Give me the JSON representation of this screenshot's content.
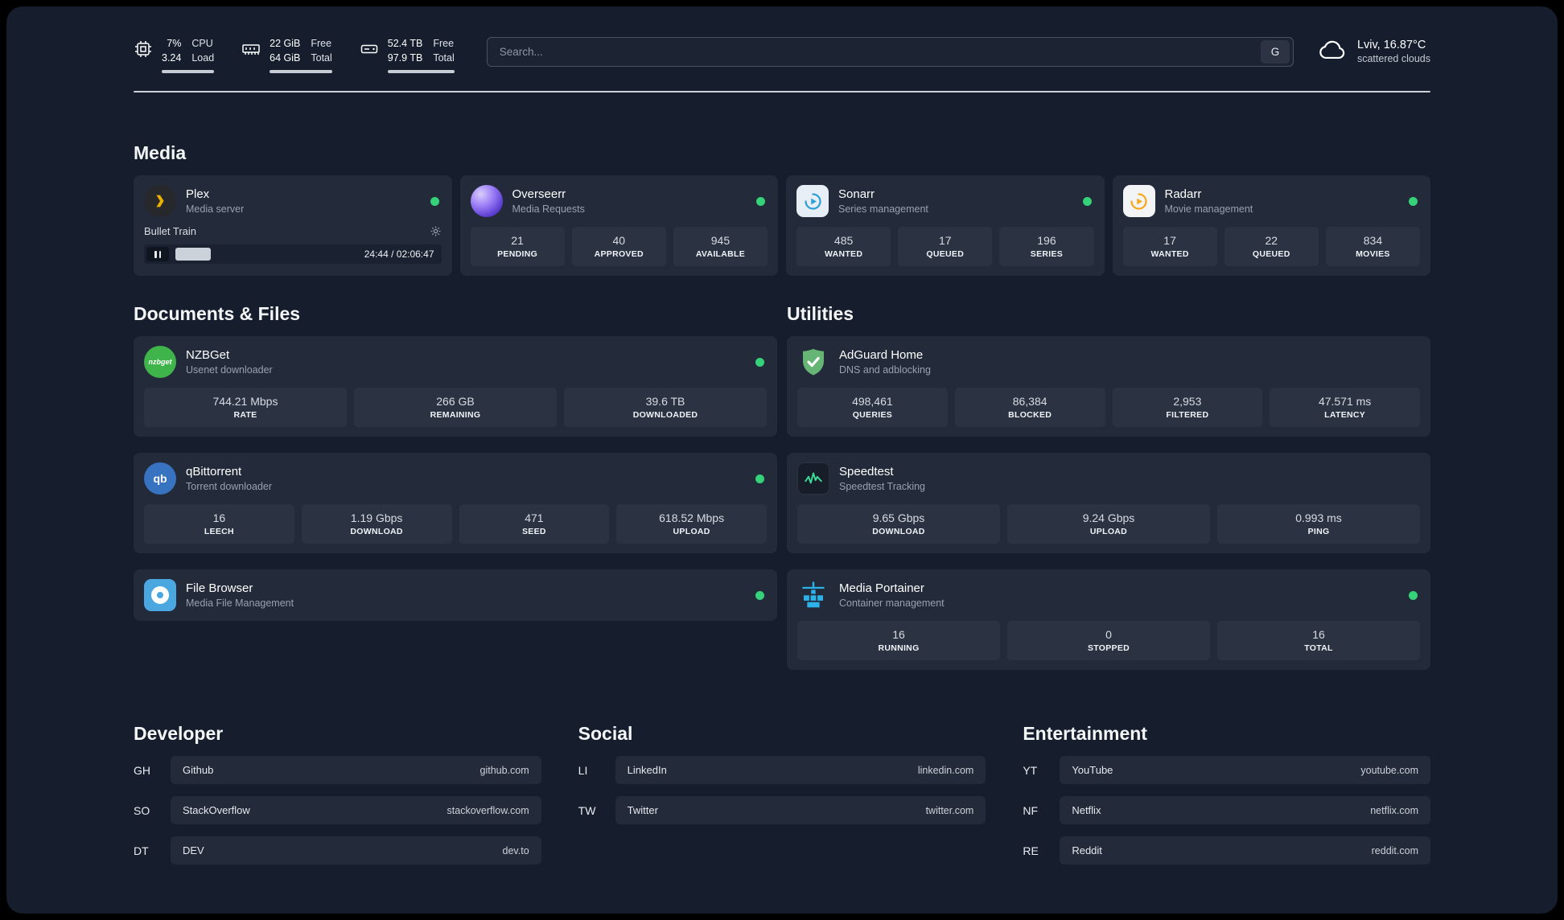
{
  "topbar": {
    "cpu": {
      "value_top": "7%",
      "value_bottom": "3.24",
      "label_top": "CPU",
      "label_bottom": "Load"
    },
    "ram": {
      "value_top": "22 GiB",
      "value_bottom": "64 GiB",
      "label_top": "Free",
      "label_bottom": "Total"
    },
    "disk": {
      "value_top": "52.4 TB",
      "value_bottom": "97.9 TB",
      "label_top": "Free",
      "label_bottom": "Total"
    },
    "search": {
      "placeholder": "Search...",
      "engine_button": "G"
    },
    "weather": {
      "location": "Lviv, 16.87°C",
      "condition": "scattered clouds"
    }
  },
  "sections": {
    "media": {
      "title": "Media",
      "plex": {
        "name": "Plex",
        "subtitle": "Media server",
        "now_playing": "Bullet Train",
        "time": "24:44 / 02:06:47"
      },
      "overseerr": {
        "name": "Overseerr",
        "subtitle": "Media Requests",
        "stats": [
          {
            "value": "21",
            "label": "PENDING"
          },
          {
            "value": "40",
            "label": "APPROVED"
          },
          {
            "value": "945",
            "label": "AVAILABLE"
          }
        ]
      },
      "sonarr": {
        "name": "Sonarr",
        "subtitle": "Series management",
        "stats": [
          {
            "value": "485",
            "label": "WANTED"
          },
          {
            "value": "17",
            "label": "QUEUED"
          },
          {
            "value": "196",
            "label": "SERIES"
          }
        ]
      },
      "radarr": {
        "name": "Radarr",
        "subtitle": "Movie management",
        "stats": [
          {
            "value": "17",
            "label": "WANTED"
          },
          {
            "value": "22",
            "label": "QUEUED"
          },
          {
            "value": "834",
            "label": "MOVIES"
          }
        ]
      }
    },
    "documents": {
      "title": "Documents & Files",
      "nzbget": {
        "name": "NZBGet",
        "subtitle": "Usenet downloader",
        "icon_text": "nzbget",
        "stats": [
          {
            "value": "744.21 Mbps",
            "label": "RATE"
          },
          {
            "value": "266 GB",
            "label": "REMAINING"
          },
          {
            "value": "39.6 TB",
            "label": "DOWNLOADED"
          }
        ]
      },
      "qbittorrent": {
        "name": "qBittorrent",
        "subtitle": "Torrent downloader",
        "icon_text": "qb",
        "stats": [
          {
            "value": "16",
            "label": "LEECH"
          },
          {
            "value": "1.19 Gbps",
            "label": "DOWNLOAD"
          },
          {
            "value": "471",
            "label": "SEED"
          },
          {
            "value": "618.52 Mbps",
            "label": "UPLOAD"
          }
        ]
      },
      "filebrowser": {
        "name": "File Browser",
        "subtitle": "Media File Management"
      }
    },
    "utilities": {
      "title": "Utilities",
      "adguard": {
        "name": "AdGuard Home",
        "subtitle": "DNS and adblocking",
        "stats": [
          {
            "value": "498,461",
            "label": "QUERIES"
          },
          {
            "value": "86,384",
            "label": "BLOCKED"
          },
          {
            "value": "2,953",
            "label": "FILTERED"
          },
          {
            "value": "47.571 ms",
            "label": "LATENCY"
          }
        ]
      },
      "speedtest": {
        "name": "Speedtest",
        "subtitle": "Speedtest Tracking",
        "stats": [
          {
            "value": "9.65 Gbps",
            "label": "DOWNLOAD"
          },
          {
            "value": "9.24 Gbps",
            "label": "UPLOAD"
          },
          {
            "value": "0.993 ms",
            "label": "PING"
          }
        ]
      },
      "portainer": {
        "name": "Media Portainer",
        "subtitle": "Container management",
        "stats": [
          {
            "value": "16",
            "label": "RUNNING"
          },
          {
            "value": "0",
            "label": "STOPPED"
          },
          {
            "value": "16",
            "label": "TOTAL"
          }
        ]
      }
    },
    "developer": {
      "title": "Developer",
      "links": [
        {
          "abbr": "GH",
          "name": "Github",
          "url": "github.com"
        },
        {
          "abbr": "SO",
          "name": "StackOverflow",
          "url": "stackoverflow.com"
        },
        {
          "abbr": "DT",
          "name": "DEV",
          "url": "dev.to"
        }
      ]
    },
    "social": {
      "title": "Social",
      "links": [
        {
          "abbr": "LI",
          "name": "LinkedIn",
          "url": "linkedin.com"
        },
        {
          "abbr": "TW",
          "name": "Twitter",
          "url": "twitter.com"
        }
      ]
    },
    "entertainment": {
      "title": "Entertainment",
      "links": [
        {
          "abbr": "YT",
          "name": "YouTube",
          "url": "youtube.com"
        },
        {
          "abbr": "NF",
          "name": "Netflix",
          "url": "netflix.com"
        },
        {
          "abbr": "RE",
          "name": "Reddit",
          "url": "reddit.com"
        }
      ]
    }
  },
  "colors": {
    "status_online": "#35d27a",
    "plex_accent": "#ebaf00",
    "page_bg": "#161e2d",
    "card_bg": "#232b3a"
  }
}
